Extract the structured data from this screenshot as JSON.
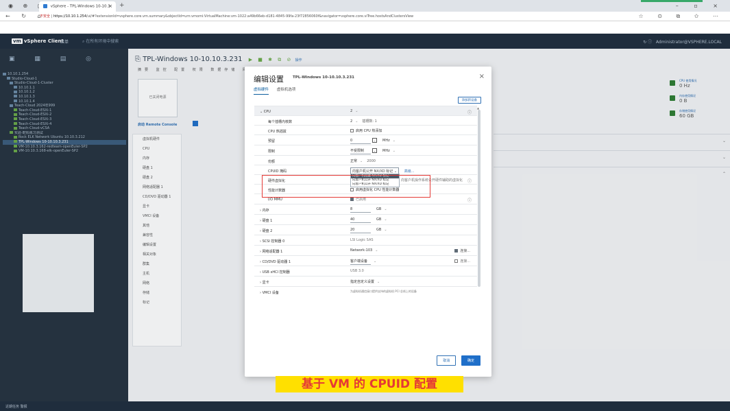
{
  "browser": {
    "tab_title": "vSphere - TPL-Windows 10-10.1",
    "url_warning": "不安全",
    "url_host": "https://10.10.1.254",
    "url_path": "/ui/#?extensionId=vsphere.core.vm.summary&objectId=urn:vmomi:VirtualMachine:vm-1022:a49b66eb-d181-4845-99fa-23f72856060f&navigator=vsphere.core.viTree.hostsAndClustersView"
  },
  "vsphere": {
    "logo": "vm",
    "app_name": "vSphere Client",
    "menu_label": "菜单",
    "search_placeholder": "在所有环境中搜索",
    "user_label": "Administrator@VSPHERE.LOCAL"
  },
  "tree": {
    "items": [
      "10.10.1.254",
      "Studio-Cloud-1",
      "Studio-Cloud-1-Cluster",
      "10.10.1.1",
      "10.10.1.2",
      "10.10.1.3",
      "10.10.1.4",
      "Teach-Cloud 2024年999",
      "Teach-Cloud-ESXi-1",
      "Teach-Cloud-ESXi-2",
      "Teach-Cloud-ESXi-3",
      "Teach-Cloud-ESXi-4",
      "Teach-Cloud-vCSA",
      "实验-靶机练习测试",
      "Rock ELK Network Ubuntu 10.10.3.212",
      "TPL-Windows 10-10.10.3.231",
      "VM-10.10.3.162-redteam-openEuler-SP2",
      "VM-10.10.3.168-elk-openEuler-SP2"
    ],
    "selected_index": 15
  },
  "main": {
    "vm_title": "TPL-Windows 10-10.10.3.231",
    "actions_label": "操作",
    "tabs_text": "摘要 监控 配置 权限 数据存储 网络",
    "thumb_label": "已关闭电源",
    "launch_console": "启动 Remote Console",
    "left_items": [
      "虚拟机硬件",
      "CPU",
      "内存",
      "硬盘 1",
      "硬盘 2",
      "网络适配器 1",
      "CD/DVD 驱动器 1",
      "显卡",
      "VMCI 设备",
      "其他",
      "兼容性",
      "编辑设置",
      "相关对象",
      "群集",
      "主机",
      "网络",
      "存储",
      "标记"
    ],
    "stats": [
      {
        "label": "CPU 使用情况",
        "value": "0 Hz"
      },
      {
        "label": "内存使用情况",
        "value": "0 B"
      },
      {
        "label": "存储使用情况",
        "value": "60 GB"
      }
    ]
  },
  "dialog": {
    "title": "编辑设置",
    "subtitle": "TPL-Windows 10-10.10.3.231",
    "tabs": [
      "虚拟硬件",
      "虚拟机选项"
    ],
    "add_device": "添加新设备",
    "rows": {
      "cpu": {
        "label": "CPU",
        "value": "2"
      },
      "cores": {
        "label": "每个插槽内核数",
        "value": "2",
        "extra": "插槽数: 1"
      },
      "hotplug": {
        "label": "CPU 热插拔",
        "value": "启用 CPU 热添加"
      },
      "reservation": {
        "label": "预留",
        "value": "0",
        "unit": "MHz"
      },
      "limit": {
        "label": "限制",
        "value": "不受限制",
        "unit": "MHz"
      },
      "shares": {
        "label": "份额",
        "value": "正常",
        "extra": "2000"
      },
      "cpuid": {
        "label": "CPUID 掩码",
        "value": "向客户机公开 NX/XD 标记",
        "adv": "高级..."
      },
      "hv": {
        "label": "硬件虚拟化",
        "value": "向客户机操作系统公开硬件辅助的虚拟化"
      },
      "perf": {
        "label": "性能计数器",
        "value": "启用虚拟化 CPU 性能计数器"
      },
      "iommu": {
        "label": "I/O MMU",
        "value": "已启用"
      },
      "mem": {
        "label": "内存",
        "value": "8",
        "unit": "GB"
      },
      "disk1": {
        "label": "硬盘 1",
        "value": "40",
        "unit": "GB"
      },
      "disk2": {
        "label": "硬盘 2",
        "value": "20",
        "unit": "GB"
      },
      "scsi": {
        "label": "SCSI 控制器 0",
        "value": "LSI Logic SAS"
      },
      "nic": {
        "label": "网络适配器 1",
        "value": "Network-103",
        "check": "连接..."
      },
      "cd": {
        "label": "CD/DVD 驱动器 1",
        "value": "客户端设备",
        "check": "连接..."
      },
      "usb": {
        "label": "USB xHCI 控制器",
        "value": "USB 3.0"
      },
      "video": {
        "label": "显卡",
        "value": "指定自定义设置"
      },
      "vmci": {
        "label": "VMCI 设备",
        "value": "为虚拟机通信接口提供支持的虚拟机 PCI 总线上的设备"
      }
    },
    "cpuid_options": [
      "向客户机隐藏 NX/XD 标记",
      "向客户机公开 NX/XD 标记",
      "向客户机公开 NX/XD 标记"
    ],
    "cancel": "取消",
    "ok": "确定"
  },
  "caption": "基于 VM 的 CPUID 配置",
  "status_bar": "近期任务  警报",
  "colors": {
    "highlight": "#e53935",
    "caption_bg": "#ffe000",
    "caption_fg": "#e53935",
    "primary": "#1f6fc9"
  }
}
